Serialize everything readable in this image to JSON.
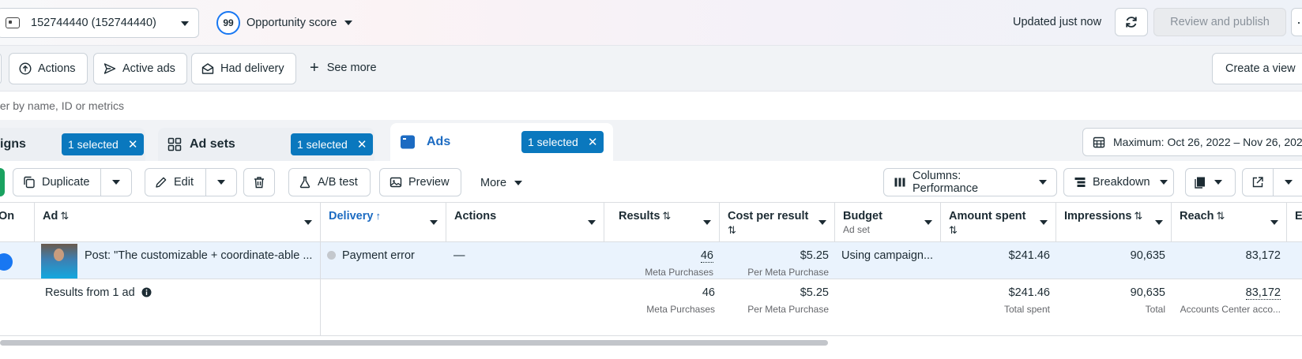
{
  "header": {
    "account": "152744440 (152744440)",
    "opportunity_score": "99",
    "opportunity_label": "Opportunity score",
    "updated": "Updated just now",
    "review_publish": "Review and publish",
    "more": "···"
  },
  "filters": {
    "chips": [
      "Actions",
      "Active ads",
      "Had delivery"
    ],
    "see_more": "See more",
    "create_view": "Create a view",
    "search_placeholder": "Search to filter by name, ID or metrics",
    "search_visible": "ter by name, ID or metrics"
  },
  "tabs": {
    "campaigns": "igns",
    "ad_sets": "Ad sets",
    "ads": "Ads",
    "selected": "1 selected",
    "date_range": "Maximum: Oct 26, 2022 – Nov 26, 202"
  },
  "toolbar": {
    "duplicate": "Duplicate",
    "edit": "Edit",
    "ab_test": "A/B test",
    "preview": "Preview",
    "more": "More",
    "columns": "Columns: Performance",
    "breakdown": "Breakdown"
  },
  "table": {
    "headers": {
      "on": "On",
      "ad": "Ad",
      "delivery": "Delivery",
      "actions": "Actions",
      "results": "Results",
      "cost_per_result": "Cost per result",
      "budget": "Budget",
      "budget_sub": "Ad set",
      "amount_spent": "Amount spent",
      "impressions": "Impressions",
      "reach": "Reach",
      "next": "E"
    },
    "row": {
      "ad_name": "Post: \"The customizable + coordinate-able ...",
      "delivery": "Payment error",
      "actions": "—",
      "results": "46",
      "results_sub": "Meta Purchases",
      "cost": "$5.25",
      "cost_sub": "Per Meta Purchase",
      "budget": "Using campaign...",
      "amount": "$241.46",
      "impressions": "90,635",
      "reach": "83,172"
    },
    "summary": {
      "label": "Results from 1 ad",
      "results": "46",
      "results_sub": "Meta Purchases",
      "cost": "$5.25",
      "cost_sub": "Per Meta Purchase",
      "amount": "$241.46",
      "amount_sub": "Total spent",
      "impressions": "90,635",
      "impressions_sub": "Total",
      "reach": "83,172",
      "reach_sub": "Accounts Center acco..."
    }
  }
}
